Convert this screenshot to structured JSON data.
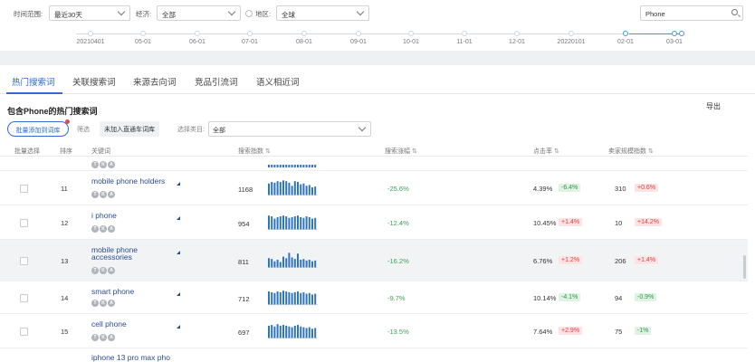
{
  "filters": {
    "time_label": "时间范围:",
    "time_value": "最近30天",
    "category_label": "经济:",
    "category_value": "全部",
    "region_label": "地区:",
    "region_value": "全球",
    "search_value": "Phone"
  },
  "timeline": {
    "labels": [
      "20210401",
      "05-01",
      "06-01",
      "07-01",
      "08-01",
      "09-01",
      "10-01",
      "11-01",
      "12-01",
      "20220101",
      "02-01",
      "03-01"
    ],
    "active_range": [
      "02-01",
      "03-01"
    ]
  },
  "tabs": [
    "热门搜索词",
    "关联搜索词",
    "来源去向词",
    "竞品引流词",
    "语义相近词"
  ],
  "active_tab": "热门搜索词",
  "section": {
    "title": "包含Phone的热门搜索词",
    "export_label": "导出",
    "batch_button": "批量添加到词库",
    "filter_label": "筛选",
    "filter_tag": "未加入直通车词库",
    "cat_label": "选择类目:",
    "cat_value": "全部"
  },
  "table": {
    "headers": {
      "select": "批量选择",
      "rank": "排序",
      "keyword": "关键词",
      "search_index": "搜索指数",
      "search_growth": "搜索涨幅",
      "ctr": "点击率",
      "seller_scale": "卖家规模指数"
    },
    "icon_letters": [
      "T",
      "K",
      "A"
    ],
    "rows": [
      {
        "rank": "11",
        "keyword": "mobile phone holders",
        "index": "1168",
        "growth": "-25.6%",
        "ctr": "4.39%",
        "ctr_change": "-6.4%",
        "ctr_dir": "down",
        "seller": "310",
        "seller_change": "+0.6%",
        "seller_dir": "up",
        "bars": [
          0.75,
          0.85,
          0.8,
          0.9,
          0.85,
          0.95,
          0.9,
          0.8,
          0.6,
          0.9,
          0.85,
          0.7,
          0.75,
          0.6,
          0.65,
          0.5,
          0.55
        ]
      },
      {
        "rank": "12",
        "keyword": "i phone",
        "index": "954",
        "growth": "-12.4%",
        "ctr": "10.45%",
        "ctr_change": "+1.4%",
        "ctr_dir": "up",
        "seller": "10",
        "seller_change": "+14.2%",
        "seller_dir": "up",
        "bars": [
          0.9,
          0.85,
          0.7,
          0.8,
          0.85,
          0.9,
          0.85,
          0.75,
          0.8,
          0.85,
          0.9,
          0.8,
          0.75,
          0.85,
          0.8,
          0.7,
          0.75
        ]
      },
      {
        "rank": "13",
        "keyword": "mobile phone accessories",
        "index": "811",
        "growth": "-16.2%",
        "ctr": "6.76%",
        "ctr_change": "+1.2%",
        "ctr_dir": "up",
        "seller": "206",
        "seller_change": "+1.4%",
        "seller_dir": "up",
        "bars": [
          0.6,
          0.55,
          0.4,
          0.5,
          0.35,
          0.7,
          0.6,
          0.95,
          0.65,
          0.55,
          0.9,
          0.5,
          0.55,
          0.45,
          0.5,
          0.4,
          0.45
        ]
      },
      {
        "rank": "14",
        "keyword": "smart phone",
        "index": "712",
        "growth": "-9.7%",
        "ctr": "10.14%",
        "ctr_change": "-4.1%",
        "ctr_dir": "down",
        "seller": "94",
        "seller_change": "-0.9%",
        "seller_dir": "down",
        "bars": [
          0.85,
          0.8,
          0.75,
          0.85,
          0.8,
          0.9,
          0.85,
          0.8,
          0.75,
          0.8,
          0.85,
          0.75,
          0.8,
          0.7,
          0.75,
          0.65,
          0.7
        ]
      },
      {
        "rank": "15",
        "keyword": "cell phone",
        "index": "697",
        "growth": "-13.5%",
        "ctr": "7.64%",
        "ctr_change": "+2.9%",
        "ctr_dir": "up",
        "seller": "75",
        "seller_change": "-1%",
        "seller_dir": "down",
        "bars": [
          0.8,
          0.85,
          0.75,
          0.9,
          0.8,
          0.85,
          0.8,
          0.75,
          0.7,
          0.8,
          0.85,
          0.75,
          0.7,
          0.65,
          0.7,
          0.6,
          0.65
        ]
      }
    ],
    "partial_next_keyword": "iphone 13 pro max pho"
  }
}
